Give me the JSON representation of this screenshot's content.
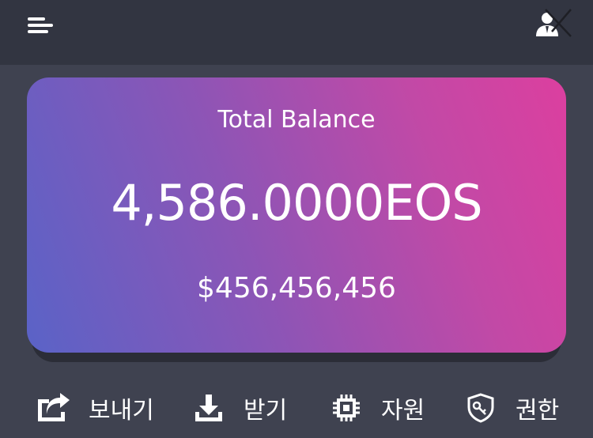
{
  "header": {
    "menu_icon": "menu-icon",
    "account_icon": "account-switch-icon"
  },
  "balance_card": {
    "label": "Total Balance",
    "amount": "4,586.0000EOS",
    "usd_value": "$456,456,456"
  },
  "actions": [
    {
      "label": "보내기",
      "icon": "send-icon"
    },
    {
      "label": "받기",
      "icon": "download-icon"
    },
    {
      "label": "자원",
      "icon": "chip-icon"
    },
    {
      "label": "권한",
      "icon": "shield-key-icon"
    }
  ],
  "colors": {
    "topbar": "#323541",
    "background": "#3f4250",
    "gradient_start": "#5a63c7",
    "gradient_end": "#dc3f9f",
    "text": "#ffffff"
  }
}
